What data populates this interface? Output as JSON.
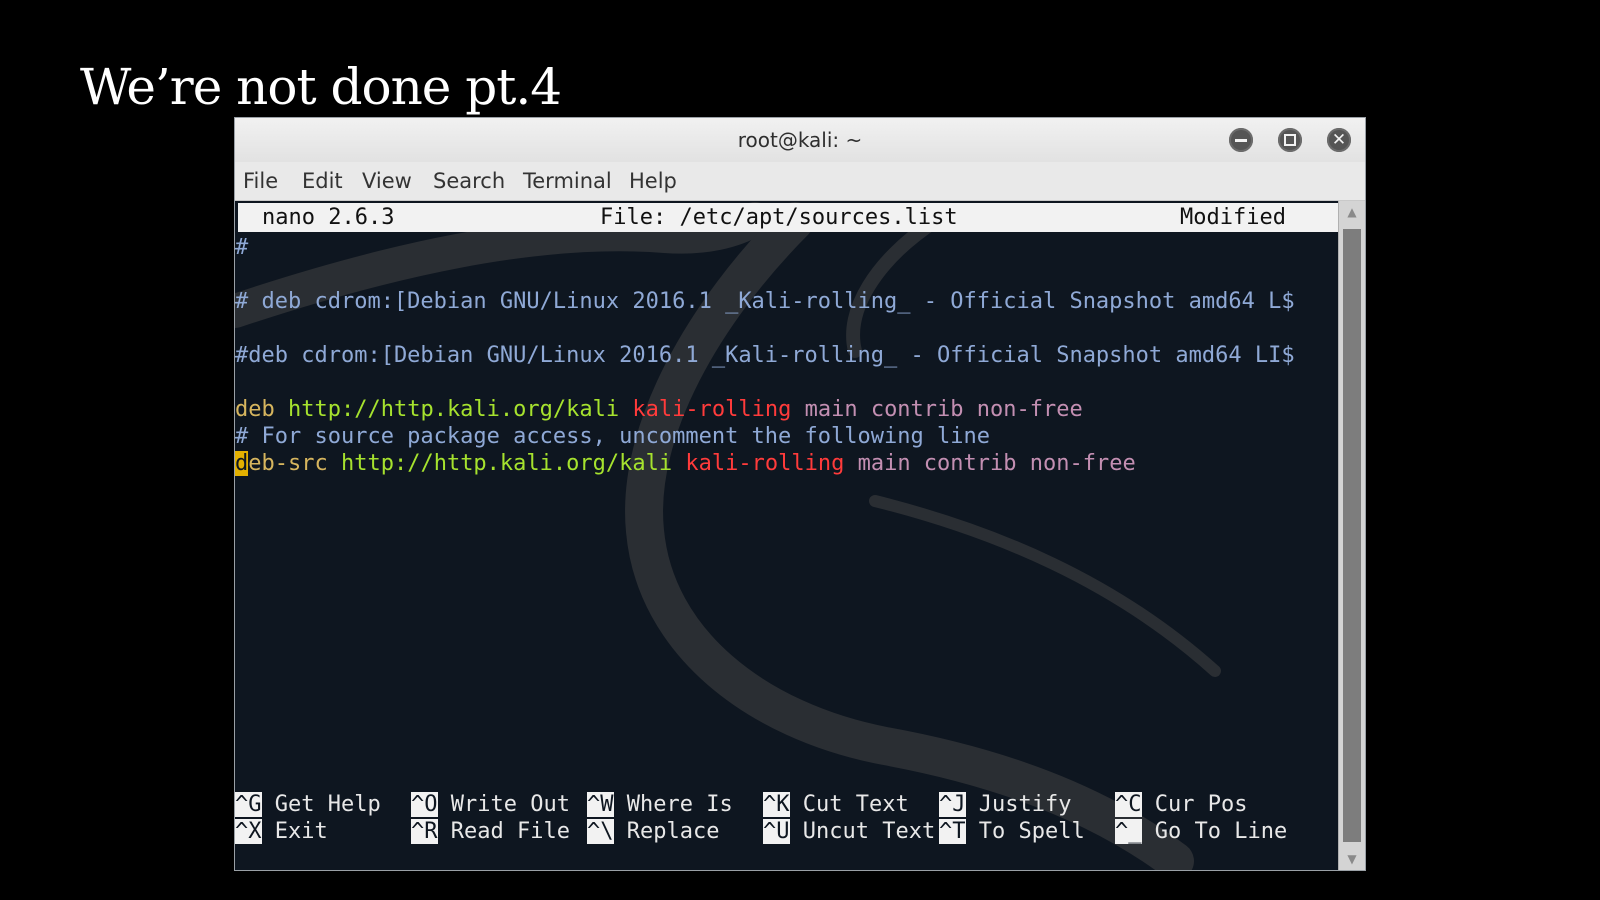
{
  "slide": {
    "title": "We’re not done pt.4"
  },
  "window": {
    "title": "root@kali: ~",
    "controls": [
      "minimize-icon",
      "maximize-icon",
      "close-icon"
    ]
  },
  "menu": [
    "File",
    "Edit",
    "View",
    "Search",
    "Terminal",
    "Help"
  ],
  "nano": {
    "version": "nano 2.6.3",
    "file": "File: /etc/apt/sources.list",
    "status": "Modified"
  },
  "content": {
    "hash": "#",
    "line1": "# deb cdrom:[Debian GNU/Linux 2016.1 _Kali-rolling_ - Official Snapshot amd64 L$",
    "line2": "#deb cdrom:[Debian GNU/Linux 2016.1 _Kali-rolling_ - Official Snapshot amd64 LI$",
    "deb": {
      "type": "deb",
      "url": "http://http.kali.org/kali",
      "suite": "kali-rolling",
      "components": "main contrib non-free"
    },
    "comment": "# For source package access, uncomment the following line",
    "debsrc": {
      "cursor_char": "d",
      "type_rest": "eb-src",
      "url": "http://http.kali.org/kali",
      "suite": "kali-rolling",
      "components": "main contrib non-free"
    }
  },
  "shortcuts": {
    "row1": [
      {
        "key": "^G",
        "label": "Get Help"
      },
      {
        "key": "^O",
        "label": "Write Out"
      },
      {
        "key": "^W",
        "label": "Where Is"
      },
      {
        "key": "^K",
        "label": "Cut Text"
      },
      {
        "key": "^J",
        "label": "Justify"
      },
      {
        "key": "^C",
        "label": "Cur Pos"
      }
    ],
    "row2": [
      {
        "key": "^X",
        "label": "Exit"
      },
      {
        "key": "^R",
        "label": "Read File"
      },
      {
        "key": "^\\",
        "label": "Replace"
      },
      {
        "key": "^U",
        "label": "Uncut Text"
      },
      {
        "key": "^T",
        "label": "To Spell"
      },
      {
        "key": "^_",
        "label": "Go To Line"
      }
    ]
  },
  "colors": {
    "terminal_bg": "#0e1620",
    "comment": "#8fa9d6",
    "url": "#a6e22e",
    "suite": "#ff3b3b",
    "components": "#c38fb2",
    "cursor": "#e3b000"
  }
}
